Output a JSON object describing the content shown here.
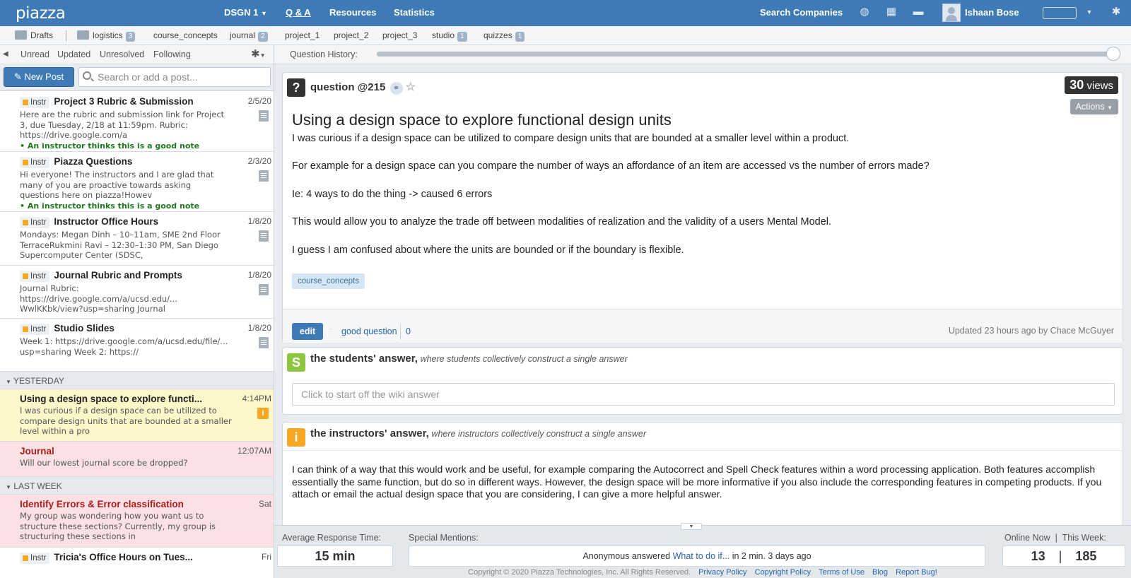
{
  "topnav": {
    "logo": "piazza",
    "course": "DSGN 1",
    "qa": "Q & A",
    "resources": "Resources",
    "statistics": "Statistics",
    "search_companies": "Search Companies",
    "user_name": "Ishaan Bose"
  },
  "folders": [
    {
      "label": "Drafts"
    },
    {
      "label": "logistics",
      "count": "3"
    },
    {
      "label": "course_concepts"
    },
    {
      "label": "journal",
      "count": "2"
    },
    {
      "label": "project_1"
    },
    {
      "label": "project_2"
    },
    {
      "label": "project_3"
    },
    {
      "label": "studio",
      "count": "1"
    },
    {
      "label": "quizzes",
      "count": "1"
    }
  ],
  "filters": {
    "unread": "Unread",
    "updated": "Updated",
    "unresolved": "Unresolved",
    "following": "Following"
  },
  "new_post": "New Post",
  "search_placeholder": "Search or add a post...",
  "instr_tag": "Instr",
  "good_note_text": "An instructor thinks this is a good note",
  "posts": [
    {
      "title": "Project 3 Rubric & Submission",
      "date": "2/5/20",
      "body": "Here are the rubric and submission link for Project 3, due Tuesday, 2/18 at 11:59pm. Rubric: https://drive.google.com/a"
    },
    {
      "title": "Piazza Questions",
      "date": "2/3/20",
      "body": "Hi everyone! The instructors and I are glad that many of you are proactive towards asking questions here on piazza!Howev"
    },
    {
      "title": "Instructor Office Hours",
      "date": "1/8/20",
      "body": "Mondays: Megan Dinh – 10–11am, SME 2nd Floor TerraceRukmini Ravi – 12:30–1:30 PM, San Diego Supercomputer Center (SDSC,"
    },
    {
      "title": "Journal Rubric and Prompts",
      "date": "1/8/20",
      "body": "Journal Rubric: https://drive.google.com/a/ucsd.edu/... WwlKKbk/view?usp=sharing  Journal"
    },
    {
      "title": "Studio Slides",
      "date": "1/8/20",
      "body": "Week 1: https://drive.google.com/a/ucsd.edu/file/... usp=sharing  Week 2: https://"
    }
  ],
  "groups": {
    "yesterday": "YESTERDAY",
    "last_week": "LAST WEEK"
  },
  "yesterday_posts": [
    {
      "title": "Using a design space to explore functi...",
      "date": "4:14PM",
      "body": "I was curious if a design space can be utilized to compare design units that are bounded at a smaller level within a pro"
    },
    {
      "title": "Journal",
      "date": "12:07AM",
      "body": "Will our lowest journal score be dropped?"
    }
  ],
  "lastweek_posts": [
    {
      "title": "Identify Errors & Error classification",
      "date": "Sat",
      "body": "My group was wondering how you want us to structure these sections? Currently, my group is structuring these sections in"
    },
    {
      "title": "Tricia's Office Hours on Tues...",
      "date": "Fri"
    }
  ],
  "question_history": "Question History:",
  "question": {
    "label": "question",
    "id": "@215",
    "views_count": "30",
    "views_label": "views",
    "actions": "Actions",
    "title": "Using a design space to explore functional design units",
    "paragraphs": [
      "I was curious if a design space can be utilized to compare design units that are bounded at a smaller level within a product.",
      "For example for a design space can you compare the number of ways an affordance of an item are accessed vs the number of errors made?",
      "Ie: 4 ways to do the thing -> caused 6 errors",
      "This would allow you to analyze the trade off between modalities of realization and the validity of a users Mental Model.",
      "I guess I am confused about where the units are bounded or if the boundary is flexible."
    ],
    "tag": "course_concepts",
    "edit": "edit",
    "good_question": "good question",
    "good_count": "0",
    "updated": "Updated 23 hours ago by Chace McGuyer"
  },
  "student_answer": {
    "badge": "S",
    "title": "the students' answer,",
    "subtitle": "where students collectively construct a single answer",
    "placeholder": "Click to start off the wiki answer"
  },
  "instructor_answer": {
    "badge": "i",
    "title": "the instructors' answer,",
    "subtitle": "where instructors collectively construct a single answer",
    "body": "I can think of a way that this would work and be useful, for example comparing the Autocorrect and Spell Check features within a word processing application. Both features accomplish essentially the same function, but do so in different ways. However, the design space will be more informative if you also include the corresponding features in competing products. If you attach or email the actual design space that you are considering, I can give a more helpful answer."
  },
  "footer": {
    "avg_label": "Average Response Time:",
    "avg_value": "15 min",
    "mentions_label": "Special Mentions:",
    "mention_prefix": "Anonymous answered",
    "mention_link": "What to do if...",
    "mention_suffix": "in 2 min. 3 days ago",
    "online_label": "Online Now",
    "sep": "|",
    "week_label": "This Week:",
    "online_value": "13",
    "week_value": "185",
    "copyright": "Copyright © 2020 Piazza Technologies, Inc. All Rights Reserved.",
    "links": [
      "Privacy Policy",
      "Copyright Policy",
      "Terms of Use",
      "Blog",
      "Report Bug!"
    ]
  },
  "colors": {
    "brand": "#3e7ab5",
    "student_badge": "#8dc63f",
    "instructor_badge": "#f5a623",
    "selected_post": "#fdf6c9",
    "unread_post": "#fbe1e3",
    "unread_title": "#b01c1c"
  }
}
